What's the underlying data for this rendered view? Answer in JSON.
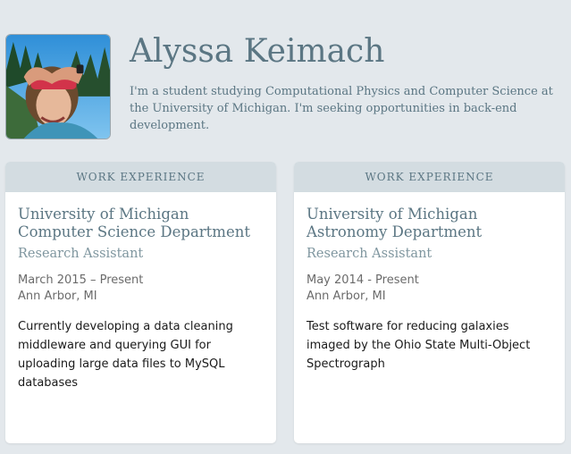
{
  "profile": {
    "name": "Alyssa Keimach",
    "bio": "I'm a student studying Computational Physics and Computer Science at the University of Michigan. I'm seeking opportunities in back-end development."
  },
  "cards": [
    {
      "header": "WORK EXPERIENCE",
      "org_line1": "University of Michigan",
      "org_line2": "Computer Science Department",
      "role": "Research Assistant",
      "dates": "March 2015 – Present",
      "location": "Ann Arbor, MI",
      "description": "Currently developing a data cleaning middleware and querying GUI for uploading large data files to MySQL databases"
    },
    {
      "header": "WORK EXPERIENCE",
      "org_line1": "University of Michigan",
      "org_line2": "Astronomy Department",
      "role": "Research Assistant",
      "dates": "May 2014 - Present",
      "location": "Ann Arbor, MI",
      "description": "Test software for reducing galaxies imaged by the Ohio State Multi-Object Spectrograph"
    }
  ],
  "colors": {
    "background": "#e3e8ec",
    "heading": "#5b7683",
    "card_header_bg": "#d3dce1",
    "card_bg": "#ffffff"
  }
}
